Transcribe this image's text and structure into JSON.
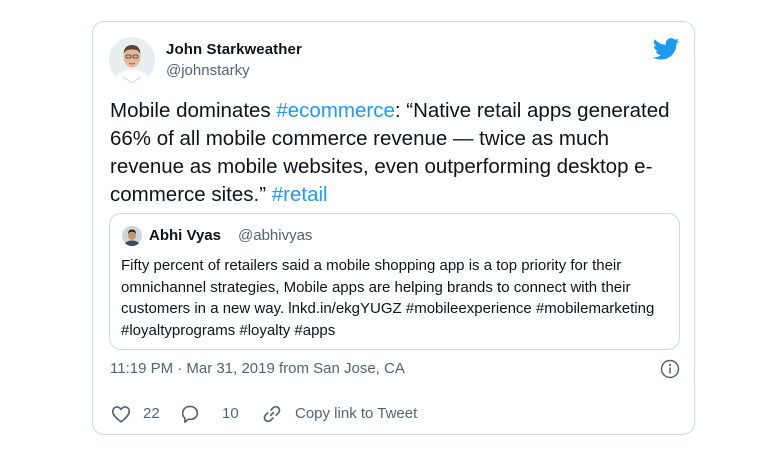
{
  "tweet": {
    "author": {
      "name": "John Starkweather",
      "handle": "@johnstarky"
    },
    "text_parts": [
      {
        "text": "Mobile dominates "
      },
      {
        "text": "#ecommerce"
      },
      {
        "text": ": “Native retail apps generated 66% of all mobile commerce revenue — twice as much revenue as mobile websites, even outperforming desktop e-commerce sites.” "
      },
      {
        "text": "#retail"
      }
    ],
    "quoted": {
      "name": "Abhi Vyas",
      "handle": "@abhivyas",
      "text_intro": "Fifty percent of retailers said a mobile shopping app is a top priority for their omnichannel strategies, Mobile apps are helping brands to connect with their customers in a new way.  ",
      "link": "lnkd.in/ekgYUGZ",
      "tags": "#mobileexperience #mobilemarketing #loyaltyprograms #loyalty #apps"
    },
    "timestamp": "11:19 PM · Mar 31, 2019 from San Jose, CA",
    "likes": "22",
    "replies": "10",
    "copy_link_label": "Copy link to Tweet"
  },
  "icons": {
    "brand": "twitter-bird-icon",
    "info": "info-icon",
    "like": "heart-icon",
    "reply": "speech-bubble-icon",
    "copy": "link-icon"
  },
  "colors": {
    "accent": "#1d9bf0",
    "text": "#0f1419",
    "secondary_text": "#536471",
    "border": "#cfd9de"
  }
}
